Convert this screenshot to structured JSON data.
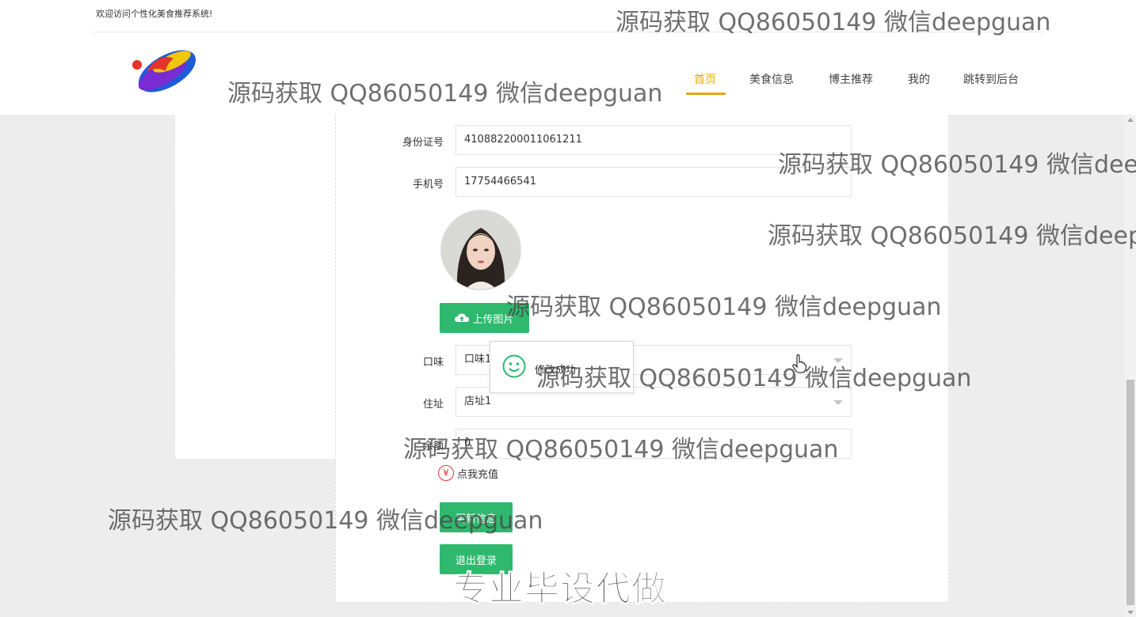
{
  "header": {
    "welcome": "欢迎访问个性化美食推荐系统!",
    "nav": [
      "首页",
      "美食信息",
      "博主推荐",
      "我的",
      "跳转到后台"
    ],
    "active_nav": "首页"
  },
  "form": {
    "id_label": "身份证号",
    "id_value": "410882200011061211",
    "phone_label": "手机号",
    "phone_value": "17754466541",
    "upload_label": "上传图片",
    "taste_label": "口味",
    "taste_value": "口味1",
    "address_label": "住址",
    "address_value": "店址1",
    "balance_label": "余额",
    "balance_value": "0",
    "recharge_label": "点我充值",
    "update_label": "更新信息",
    "logout_label": "退出登录"
  },
  "toast": {
    "message": "修改成功"
  },
  "watermarks": {
    "repeat": "源码获取 QQ86050149 微信deepguan",
    "clipped_1": "源码获取 QQ86050149 微信deep",
    "clipped_2": "源码获取 QQ86050149 微信deepg",
    "banner": "专业毕设代做"
  },
  "colors": {
    "accent": "#e8a700",
    "button": "#2fb96f",
    "recharge": "#e33333"
  }
}
